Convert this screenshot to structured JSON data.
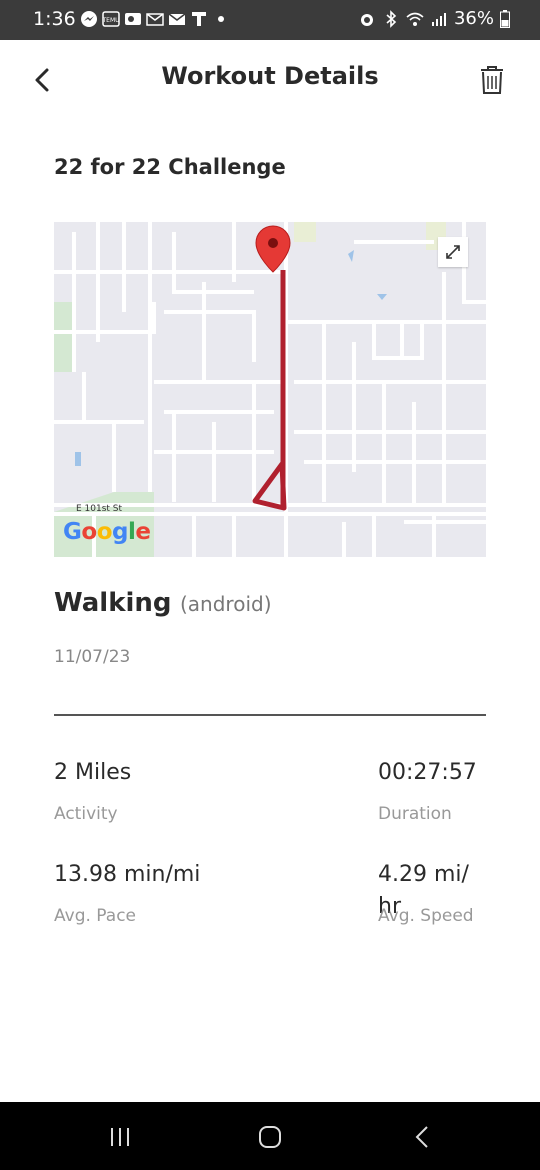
{
  "status_bar": {
    "time": "1:36",
    "battery": "36%"
  },
  "header": {
    "title": "Workout Details",
    "back_icon": "chevron-left-icon",
    "delete_icon": "trash-icon"
  },
  "challenge": {
    "title": "22 for 22 Challenge"
  },
  "map": {
    "street_label": "E 101st St",
    "provider": "Google",
    "route_color": "#b0202e",
    "marker_color": "#e53935"
  },
  "workout": {
    "activity": "Walking",
    "source": "(android)",
    "date": "11/07/23"
  },
  "stats": {
    "distance_value": "2 Miles",
    "distance_label": "Activity",
    "duration_value": "00:27:57",
    "duration_label": "Duration",
    "pace_value": "13.98 min/mi",
    "pace_label": "Avg. Pace",
    "speed_value_line1": "4.29 mi/",
    "speed_value_line2": "hr",
    "speed_label": "Avg. Speed"
  }
}
